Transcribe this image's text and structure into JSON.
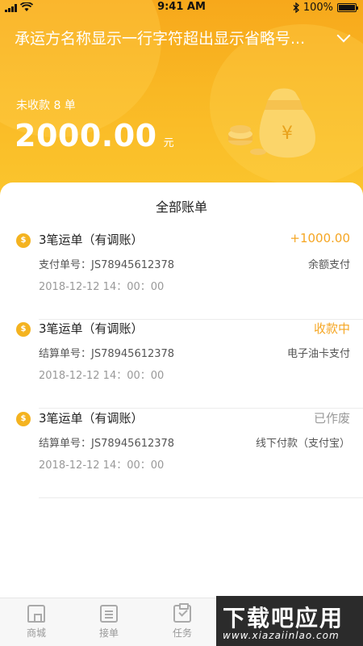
{
  "status_bar": {
    "time": "9:41 AM",
    "battery": "100%"
  },
  "header": {
    "carrier_name": "承运方名称显示一行字符超出显示省略号...",
    "unpaid_label": "未收款 8 单",
    "amount": "2000.00",
    "amount_unit": "元"
  },
  "list": {
    "title": "全部账单",
    "bills": [
      {
        "title": "3笔运单（有调账）",
        "status": "+1000.00",
        "status_color": "#f5a623",
        "number": "支付单号：JS78945612378",
        "method": "余额支付",
        "time": "2018-12-12  14：00：00"
      },
      {
        "title": "3笔运单（有调账）",
        "status": "收款中",
        "status_color": "#f5a623",
        "number": "结算单号：JS78945612378",
        "method": "电子油卡支付",
        "time": "2018-12-12  14：00：00"
      },
      {
        "title": "3笔运单（有调账）",
        "status": "已作废",
        "status_color": "#999999",
        "number": "结算单号：JS78945612378",
        "method": "线下付款（支付宝）",
        "time": "2018-12-12  14：00：00"
      }
    ]
  },
  "tabbar": {
    "home": "商城",
    "orders": "接单",
    "tasks": "任务"
  },
  "watermark": {
    "main": "下载吧应用",
    "sub": "www.xiazaiinlao.com"
  },
  "colors": {
    "accent": "#f9b824",
    "status_orange": "#f5a623",
    "status_gray": "#999999"
  },
  "icons": {
    "coin": "coin-icon",
    "chevron": "chevron-down-icon",
    "home": "home-icon",
    "orders": "list-icon",
    "tasks": "clipboard-check-icon"
  }
}
